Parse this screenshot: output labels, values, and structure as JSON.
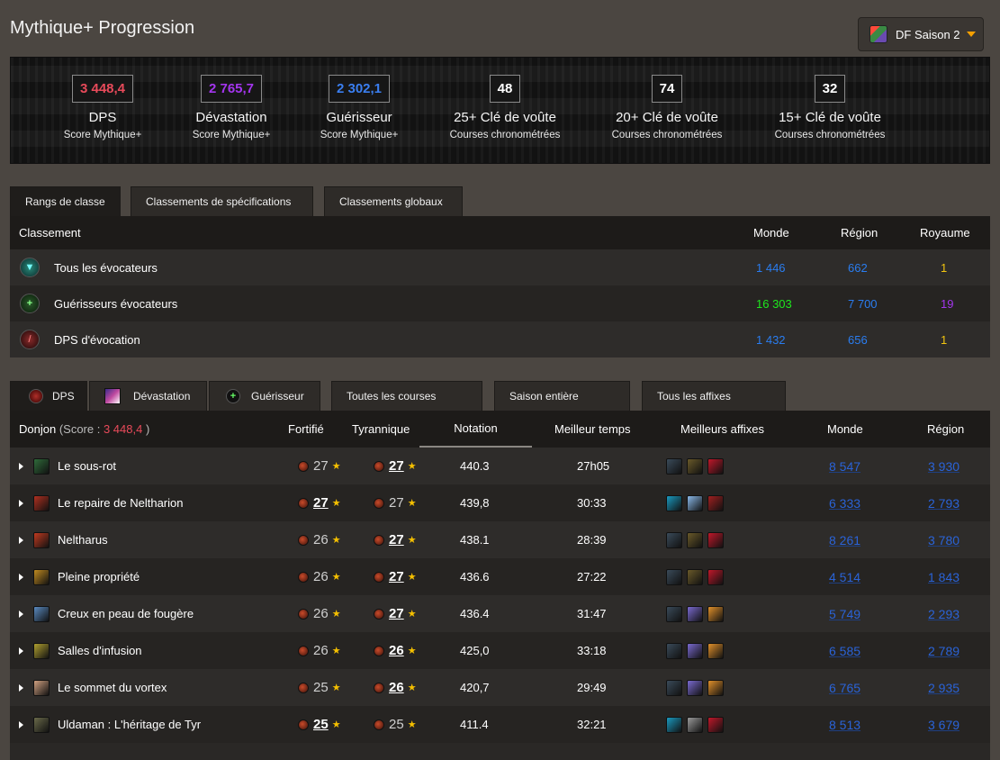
{
  "page_title": "Mythique+ Progression",
  "season": {
    "label": "DF Saison 2"
  },
  "scores": [
    {
      "value": "3 448,4",
      "label": "DPS",
      "sub": "Score Mythique+",
      "color": "#e84a5a"
    },
    {
      "value": "2 765,7",
      "label": "Dévastation",
      "sub": "Score Mythique+",
      "color": "#a335ee"
    },
    {
      "value": "2 302,1",
      "label": "Guérisseur",
      "sub": "Score Mythique+",
      "color": "#3a7ef0"
    },
    {
      "value": "48",
      "label": "25+ Clé de voûte",
      "sub": "Courses chronométrées",
      "color": "#ffffff"
    },
    {
      "value": "74",
      "label": "20+ Clé de voûte",
      "sub": "Courses chronométrées",
      "color": "#ffffff"
    },
    {
      "value": "32",
      "label": "15+ Clé de voûte",
      "sub": "Courses chronométrées",
      "color": "#ffffff"
    }
  ],
  "rank_tabs": [
    "Rangs de classe",
    "Classements de spécifications",
    "Classements globaux"
  ],
  "rank_table": {
    "headers": {
      "name": "Classement",
      "world": "Monde",
      "region": "Région",
      "realm": "Royaume"
    },
    "rows": [
      {
        "name": "Tous les évocateurs",
        "world": "1 446",
        "region": "662",
        "realm": "1",
        "world_color": "blue",
        "region_color": "blue",
        "realm_color": "gold",
        "icon": "evoker-icon"
      },
      {
        "name": "Guérisseurs évocateurs",
        "world": "16 303",
        "region": "7 700",
        "realm": "19",
        "world_color": "green",
        "region_color": "blue",
        "realm_color": "purple",
        "icon": "healer-icon"
      },
      {
        "name": "DPS d'évocation",
        "world": "1 432",
        "region": "656",
        "realm": "1",
        "world_color": "blue",
        "region_color": "blue",
        "realm_color": "gold",
        "icon": "dps-icon"
      }
    ]
  },
  "dungeon_tabs": {
    "roles": [
      "DPS",
      "Dévastation",
      "Guérisseur"
    ],
    "filters": [
      "Toutes les courses",
      "Saison entière",
      "Tous les affixes"
    ]
  },
  "dungeon_table": {
    "headers": {
      "dungeon": "Donjon",
      "score_prefix": "(Score : ",
      "score_value": "3 448,4",
      "score_suffix": " )",
      "fortified": "Fortifié",
      "tyrannical": "Tyrannique",
      "rating": "Notation",
      "best_time": "Meilleur temps",
      "best_affixes": "Meilleurs affixes",
      "world": "Monde",
      "region": "Région"
    },
    "rows": [
      {
        "name": "Le sous-rot",
        "fort": "27",
        "tyr": "27",
        "best": "tyr",
        "rating": "440.3",
        "time": "27h05",
        "world": "8 547",
        "region": "3 930",
        "icon_color": "#2f6b3a",
        "affixes": [
          "#3a4b5a",
          "#6a5a2a",
          "#c0182a"
        ]
      },
      {
        "name": "Le repaire de Neltharion",
        "fort": "27",
        "tyr": "27",
        "best": "fort",
        "rating": "439,8",
        "time": "30:33",
        "world": "6 333",
        "region": "2 793",
        "icon_color": "#b03020",
        "affixes": [
          "#1a9ac0",
          "#8ab8e8",
          "#a02020"
        ]
      },
      {
        "name": "Neltharus",
        "fort": "26",
        "tyr": "27",
        "best": "tyr",
        "rating": "438.1",
        "time": "28:39",
        "world": "8 261",
        "region": "3 780",
        "icon_color": "#c03a20",
        "affixes": [
          "#3a4b5a",
          "#6a5a2a",
          "#c0182a"
        ]
      },
      {
        "name": "Pleine propriété",
        "fort": "26",
        "tyr": "27",
        "best": "tyr",
        "rating": "436.6",
        "time": "27:22",
        "world": "4 514",
        "region": "1 843",
        "icon_color": "#c08a20",
        "affixes": [
          "#3a4b5a",
          "#6a5a2a",
          "#c0182a"
        ]
      },
      {
        "name": "Creux en peau de fougère",
        "fort": "26",
        "tyr": "27",
        "best": "tyr",
        "rating": "436.4",
        "time": "31:47",
        "world": "5 749",
        "region": "2 293",
        "icon_color": "#5a8ac0",
        "affixes": [
          "#3a4b5a",
          "#7a6ad0",
          "#e0902a"
        ]
      },
      {
        "name": "Salles d'infusion",
        "fort": "26",
        "tyr": "26",
        "best": "tyr",
        "rating": "425,0",
        "time": "33:18",
        "world": "6 585",
        "region": "2 789",
        "icon_color": "#b0a030",
        "affixes": [
          "#3a4b5a",
          "#7a6ad0",
          "#e0902a"
        ]
      },
      {
        "name": "Le sommet du vortex",
        "fort": "25",
        "tyr": "26",
        "best": "tyr",
        "rating": "420,7",
        "time": "29:49",
        "world": "6 765",
        "region": "2 935",
        "icon_color": "#d0a080",
        "affixes": [
          "#3a4b5a",
          "#7a6ad0",
          "#e0902a"
        ]
      },
      {
        "name": "Uldaman : L'héritage de Tyr",
        "fort": "25",
        "tyr": "25",
        "best": "fort",
        "rating": "411.4",
        "time": "32:21",
        "world": "8 513",
        "region": "3 679",
        "icon_color": "#6a6a4a",
        "affixes": [
          "#1a9ac0",
          "#9a9a9a",
          "#c0182a"
        ]
      }
    ]
  }
}
